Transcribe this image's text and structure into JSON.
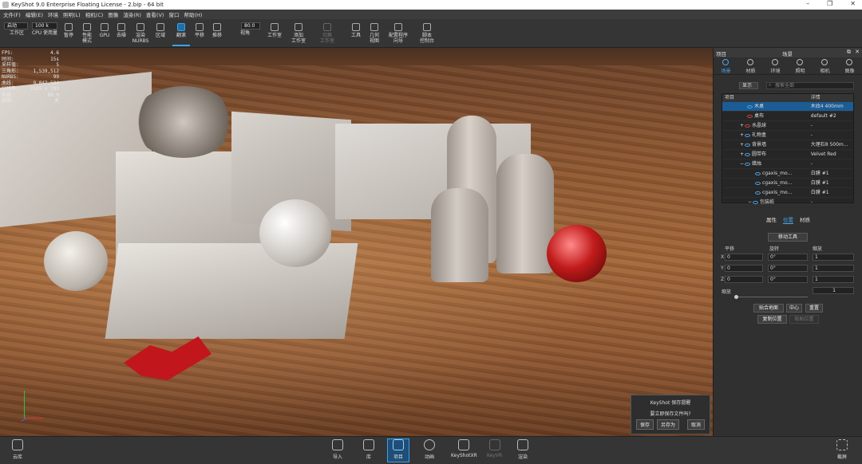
{
  "titlebar": {
    "title": "KeyShot 9.0 Enterprise Floating License  -  2.bip  -  64 bit"
  },
  "menu": [
    "文件(F)",
    "编辑(E)",
    "环境",
    "照明(L)",
    "相机(C)",
    "图像",
    "渲染(R)",
    "查看(V)",
    "窗口",
    "帮助(H)"
  ],
  "toolbar": {
    "mode_select": "启动",
    "cpu_select": "100 k",
    "focal_value": "80.0",
    "items": [
      "工作区",
      "CPU 使用量",
      "暂停",
      "性能\n模式",
      "GPU",
      "去噪",
      "渲染\nNURBS",
      "区域",
      "翻滚",
      "平移",
      "推移",
      "视角",
      "工作室",
      "添加\n工作室",
      "切换\n工作室",
      "工具",
      "几何\n视图",
      "配置程序\n向导",
      "脚本\n控制台"
    ]
  },
  "stats": [
    [
      "FPS:",
      "4.6"
    ],
    [
      "时间:",
      "15s"
    ],
    [
      "采样值:",
      "5"
    ],
    [
      "三角形:",
      "1,539,512"
    ],
    [
      "NURBS:",
      "99"
    ],
    [
      "曲线:",
      "9,047,584"
    ],
    [
      "分辨率:",
      "1585 x 793"
    ],
    [
      "焦距:",
      "80.0"
    ],
    [
      "去噪:",
      "关"
    ]
  ],
  "dialog": {
    "title": "KeyShot 保存提醒",
    "message": "要立即保存文件吗?",
    "save": "保存",
    "save_as": "另存为",
    "cancel": "取消"
  },
  "panel": {
    "left_title": "项目",
    "center_title": "场景",
    "tabs": [
      "场景",
      "材质",
      "环境",
      "照明",
      "相机",
      "图像"
    ],
    "show_select": "显示",
    "search_placeholder": "搜索全部",
    "tree_headers": [
      "项目",
      "详情"
    ],
    "tree_rows": [
      {
        "name": "木桌",
        "detail": "木纹4 400mm",
        "selected": true
      },
      {
        "name": "桌布",
        "detail": "default #2",
        "selected": false
      },
      {
        "name": "水晶球",
        "detail": "-",
        "selected": false
      },
      {
        "name": "礼物盒",
        "detail": "-",
        "selected": false
      },
      {
        "name": "背景墙",
        "detail": "大理石8 500m...",
        "selected": false
      },
      {
        "name": "圆带布",
        "detail": "Velvet Red",
        "selected": false
      },
      {
        "name": "蜡烛",
        "detail": "-",
        "selected": false
      },
      {
        "name": "cgaxis_mo...",
        "detail": "白膜 #1",
        "selected": false
      },
      {
        "name": "cgaxis_mo...",
        "detail": "白膜 #1",
        "selected": false
      },
      {
        "name": "cgaxis_mo...",
        "detail": "白膜 #1",
        "selected": false
      },
      {
        "name": "包装纸",
        "detail": "-",
        "selected": false
      }
    ],
    "subtabs": [
      "属性",
      "位置",
      "材质"
    ],
    "move_tool": "移动工具",
    "labels": {
      "translate": "平移",
      "rotate": "旋转",
      "scale": "缩放",
      "uniform_scale": "缩放"
    },
    "axes": [
      "X",
      "Y",
      "Z"
    ],
    "translate": [
      "0",
      "0",
      "0"
    ],
    "rotate": [
      "0°",
      "0°",
      "0°"
    ],
    "scale": [
      "1",
      "1",
      "1"
    ],
    "uniform_scale_value": "1",
    "snap_ground": "贴合地面",
    "center": "中心",
    "reset": "重置",
    "copy_pos": "复制位置",
    "paste_pos": "粘贴位置"
  },
  "bottom": {
    "cloud": "云库",
    "import": "导入",
    "library": "库",
    "project": "项目",
    "animation": "动画",
    "keyshotxr": "KeyShotXR",
    "keyvr": "KeyVR",
    "render": "渲染",
    "screenshot": "截屏"
  }
}
